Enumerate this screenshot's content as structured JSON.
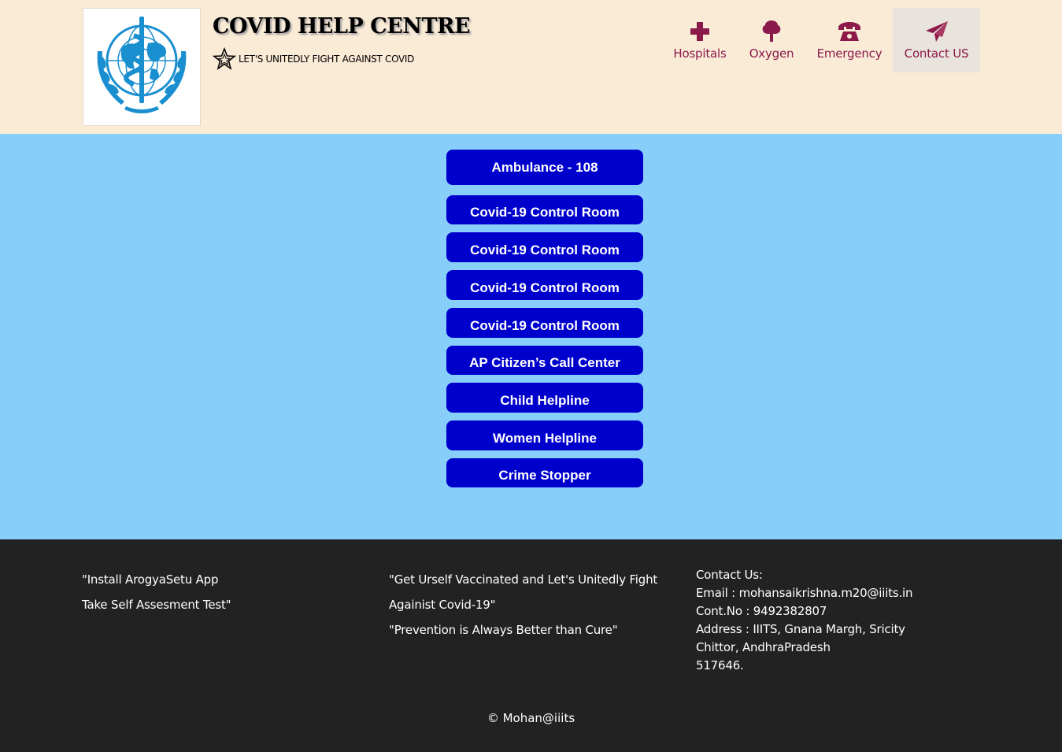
{
  "header": {
    "title": "COVID HELP CENTRE",
    "tagline": "LET'S UNITEDLY FIGHT AGAINST COVID",
    "nav": [
      {
        "label": "Hospitals",
        "icon": "plus-icon"
      },
      {
        "label": "Oxygen",
        "icon": "tree-icon"
      },
      {
        "label": "Emergency",
        "icon": "phone-icon"
      },
      {
        "label": "Contact US",
        "icon": "paper-plane-icon"
      }
    ],
    "accent_color": "#8b1a4a",
    "background_color": "#faebd7"
  },
  "helplines": {
    "button_color": "#0000cd",
    "background_color": "#87cefa",
    "buttons": [
      {
        "label": "Ambulance - 108"
      },
      {
        "label": "Covid-19 Control Room"
      },
      {
        "label": "Covid-19 Control Room"
      },
      {
        "label": "Covid-19 Control Room"
      },
      {
        "label": "Covid-19 Control Room"
      },
      {
        "label": "AP Citizen’s Call Center"
      },
      {
        "label": "Child Helpline"
      },
      {
        "label": "Women Helpline"
      },
      {
        "label": "Crime Stopper"
      }
    ]
  },
  "footer": {
    "col1": [
      "\"Install ArogyaSetu App",
      "Take Self Assesment Test\""
    ],
    "col2": [
      "\"Get Urself Vaccinated and Let's Unitedly Fight",
      "Againist Covid-19\"",
      "\"Prevention is Always Better than Cure\""
    ],
    "contact": {
      "heading": "Contact Us:",
      "email": "Email : mohansaikrishna.m20@iiits.in",
      "phone": "Cont.No : 9492382807",
      "address1": "Address : IIITS, Gnana Margh, Sricity",
      "address2": "Chittor, AndhraPradesh",
      "pincode": "517646."
    },
    "copyright": "© Mohan@iiits"
  }
}
